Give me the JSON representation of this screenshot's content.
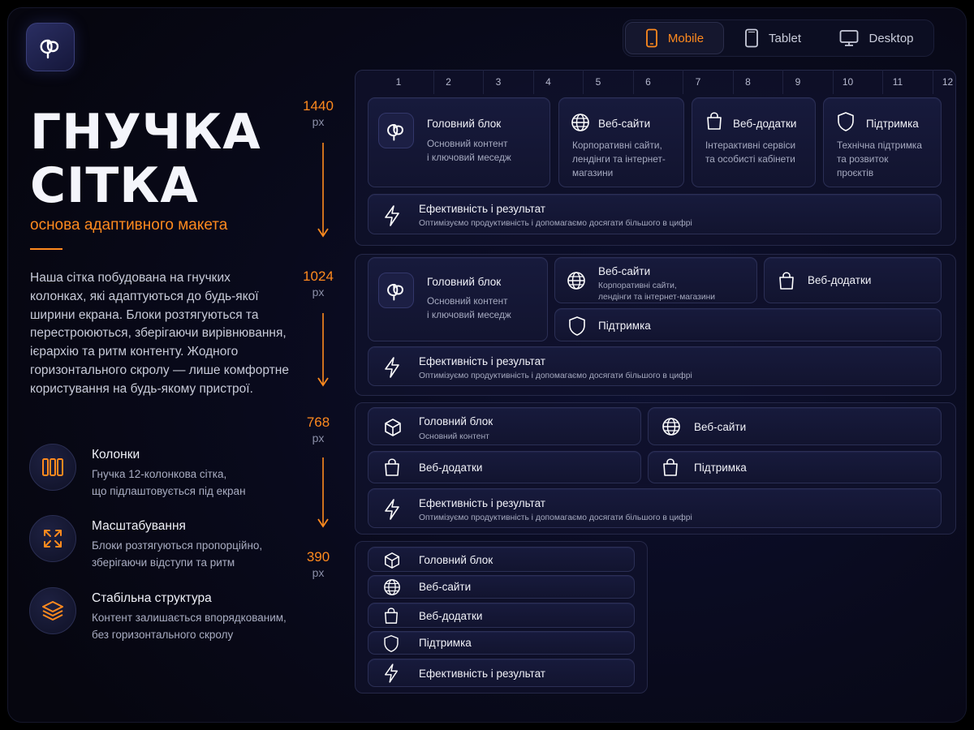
{
  "brand": {
    "logo_icon": "brand-logo-icon"
  },
  "device_switcher": {
    "items": [
      {
        "label": "Mobile",
        "icon": "smartphone-icon",
        "active": true
      },
      {
        "label": "Tablet",
        "icon": "tablet-icon",
        "active": false
      },
      {
        "label": "Desktop",
        "icon": "monitor-icon",
        "active": false
      }
    ]
  },
  "hero": {
    "title_line1": "ГНУЧКА",
    "title_line2": "СІТКА",
    "subtitle": "основа адаптивного макета",
    "description": "Наша сітка побудована на гнучких колонках, які адаптуються до будь-якої ширини екрана. Блоки розтягуються та перестроюються, зберігаючи вирівнювання, ієрархію та ритм контенту. Жодного горизонтального скролу — лише комфортне користування на будь-якому пристрої."
  },
  "features": [
    {
      "title": "Колонки",
      "line1": "Гнучка 12-колонкова сітка,",
      "line2": "що підлаштовується під екран",
      "icon": "columns-icon"
    },
    {
      "title": "Масштабування",
      "line1": "Блоки розтягуються пропорційно,",
      "line2": "зберігаючи відступи та ритм",
      "icon": "expand-icon"
    },
    {
      "title": "Стабільна структура",
      "line1": "Контент залишається впорядкованим,",
      "line2": "без горизонтального скролу",
      "icon": "layers-icon"
    }
  ],
  "breakpoints": [
    {
      "value": "1440",
      "unit": "px"
    },
    {
      "value": "1024",
      "unit": "px"
    },
    {
      "value": "768",
      "unit": "px"
    },
    {
      "value": "390",
      "unit": "px"
    }
  ],
  "grid_columns": [
    "1",
    "2",
    "3",
    "4",
    "5",
    "6",
    "7",
    "8",
    "9",
    "10",
    "11",
    "12"
  ],
  "bp1440": {
    "main": {
      "title": "Головний блок",
      "line1": "Основний контент",
      "line2": "і ключовий меседж"
    },
    "web": {
      "title": "Веб-сайти",
      "line1": "Корпоративні сайти,",
      "line2": "лендінги та інтернет-",
      "line3": "магазини"
    },
    "apps": {
      "title": "Веб-додатки",
      "line1": "Інтерактивні сервіси",
      "line2": "та особисті кабінети"
    },
    "support": {
      "title": "Підтримка",
      "line1": "Технічна підтримка",
      "line2": "та розвиток",
      "line3": "проєктів"
    },
    "perf": {
      "title": "Ефективність і результат",
      "desc": "Оптимізуємо продуктивність і допомагаємо досягати більшого в цифрі"
    }
  },
  "bp1024": {
    "main": {
      "title": "Головний блок",
      "line1": "Основний контент",
      "line2": "і ключовий меседж"
    },
    "web": {
      "title": "Веб-сайти",
      "line1": "Корпоративні сайти,",
      "line2": "лендінги та інтернет-магазини"
    },
    "apps": {
      "title": "Веб-додатки"
    },
    "support": {
      "title": "Підтримка"
    },
    "perf": {
      "title": "Ефективність і результат",
      "desc": "Оптимізуємо продуктивність і допомагаємо досягати більшого в цифрі"
    }
  },
  "bp768": {
    "main": {
      "title": "Головний блок",
      "line1": "Основний контент"
    },
    "web": {
      "title": "Веб-сайти"
    },
    "apps": {
      "title": "Веб-додатки"
    },
    "support": {
      "title": "Підтримка"
    },
    "perf": {
      "title": "Ефективність і результат",
      "desc": "Оптимізуємо продуктивність і допомагаємо досягати більшого в цифрі"
    }
  },
  "bp390": {
    "main": {
      "title": "Головний блок"
    },
    "web": {
      "title": "Веб-сайти"
    },
    "apps": {
      "title": "Веб-додатки"
    },
    "support": {
      "title": "Підтримка"
    },
    "perf": {
      "title": "Ефективність і результат"
    }
  },
  "colors": {
    "accent": "#ff8a1e",
    "background": "#090a1c",
    "card": "#15173a"
  }
}
